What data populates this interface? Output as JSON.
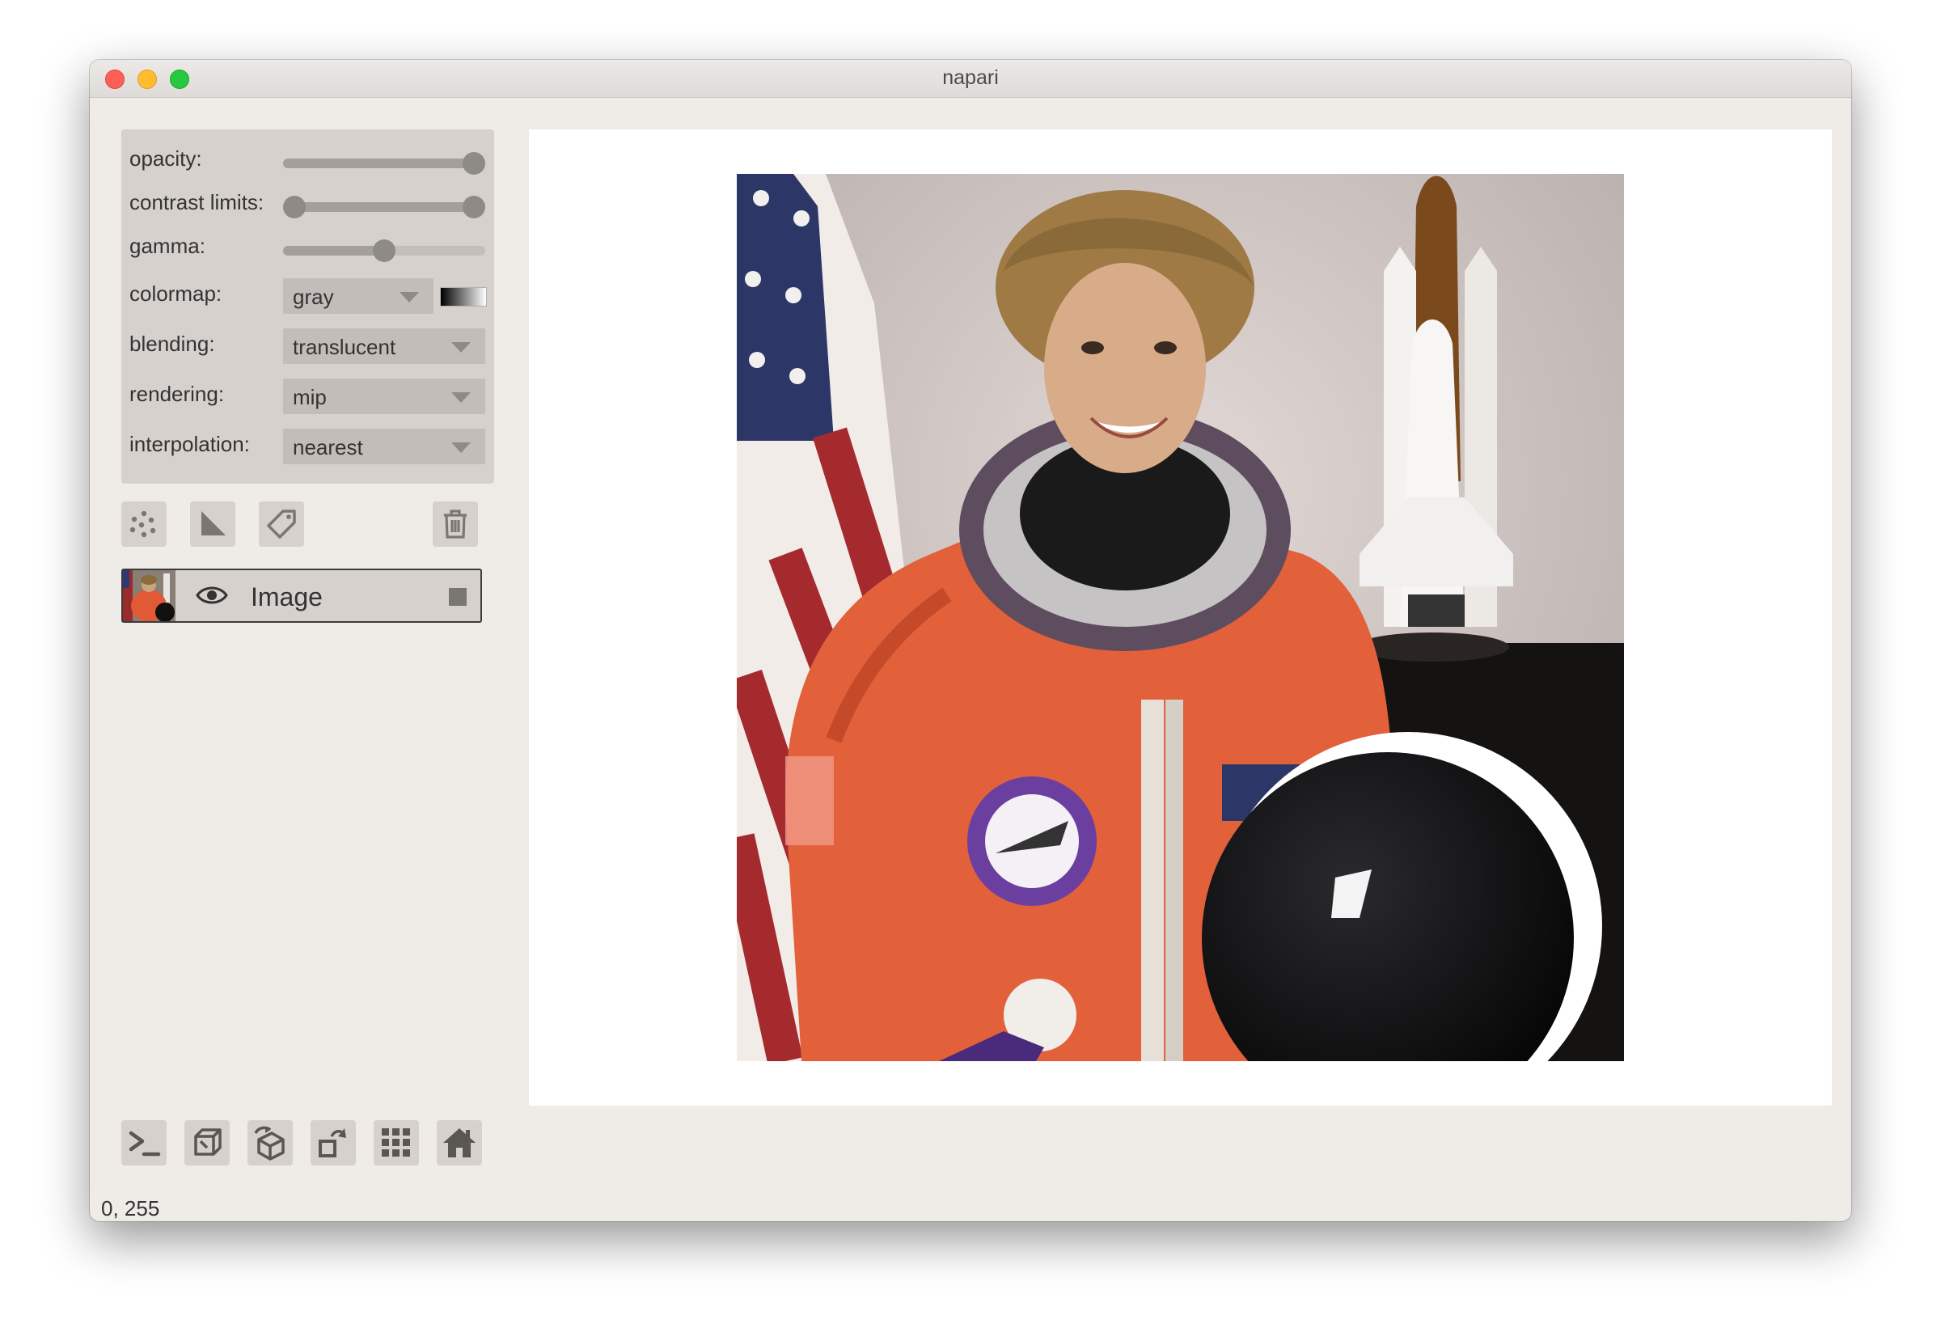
{
  "window": {
    "title": "napari"
  },
  "layer_controls": {
    "opacity": {
      "label": "opacity:",
      "value": 1.0
    },
    "contrast_limits": {
      "label": "contrast limits:",
      "min": 0,
      "max": 255,
      "range": [
        0,
        255
      ]
    },
    "gamma": {
      "label": "gamma:",
      "value": 0.5
    },
    "colormap": {
      "label": "colormap:",
      "value": "gray"
    },
    "blending": {
      "label": "blending:",
      "value": "translucent"
    },
    "rendering": {
      "label": "rendering:",
      "value": "mip"
    },
    "interpolation": {
      "label": "interpolation:",
      "value": "nearest"
    }
  },
  "layer_buttons": [
    "new-points-icon",
    "new-shapes-icon",
    "new-labels-icon",
    "delete-layer-icon"
  ],
  "layers": [
    {
      "name": "Image",
      "visible": true
    }
  ],
  "bottom_buttons": [
    "console-icon",
    "ndisplay-3d-icon",
    "roll-dims-icon",
    "transpose-dims-icon",
    "grid-view-icon",
    "home-icon"
  ],
  "status": {
    "text": "0, 255"
  },
  "colors": {
    "window_bg": "#efebe7",
    "panel_bg": "#d6d1cd",
    "canvas_bg": "#ffffff",
    "text": "#333333"
  }
}
